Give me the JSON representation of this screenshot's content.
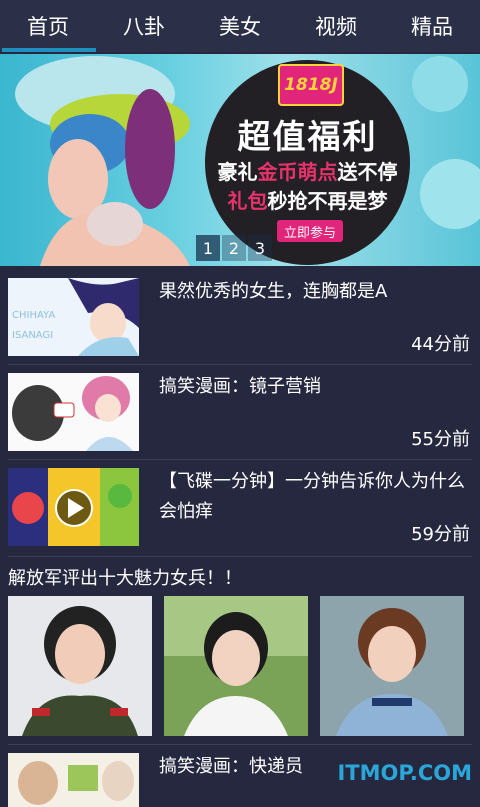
{
  "nav": {
    "tabs": [
      {
        "label": "首页",
        "active": true
      },
      {
        "label": "八卦",
        "active": false
      },
      {
        "label": "美女",
        "active": false
      },
      {
        "label": "视频",
        "active": false
      },
      {
        "label": "精品",
        "active": false
      }
    ]
  },
  "banner": {
    "logo": "1818J",
    "title": "超值福利",
    "line1_a": "豪礼",
    "line1_hl": "金币萌点",
    "line1_b": "送不停",
    "line2_hl": "礼包",
    "line2_b": "秒抢不再是梦",
    "cta": "立即参与",
    "pages": [
      "1",
      "2",
      "3"
    ]
  },
  "feed": [
    {
      "title": "果然优秀的女生，连胸都是A",
      "time": "44分前",
      "thumb": "comic-icon"
    },
    {
      "title": "搞笑漫画：镜子营销",
      "time": "55分前",
      "thumb": "comic-icon"
    },
    {
      "title": "【飞碟一分钟】一分钟告诉你人为什么会怕痒",
      "time": "59分前",
      "thumb": "video-play-icon"
    }
  ],
  "gallery": {
    "title": "解放军评出十大魅力女兵！！"
  },
  "last_item": {
    "title": "搞笑漫画：快递员"
  },
  "watermark": "ITMOP.COM"
}
